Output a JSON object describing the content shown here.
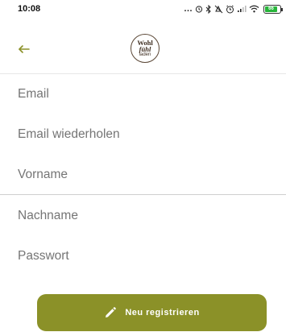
{
  "status_bar": {
    "time": "10:08",
    "battery": "66"
  },
  "header": {
    "logo_line1": "Wohl",
    "logo_line2": "fühl",
    "logo_line3": "laden"
  },
  "form": {
    "email_placeholder": "Email",
    "email_repeat_placeholder": "Email wiederholen",
    "firstname_placeholder": "Vorname",
    "lastname_placeholder": "Nachname",
    "password_placeholder": "Passwort"
  },
  "actions": {
    "register_label": "Neu registrieren"
  },
  "colors": {
    "accent": "#8b9128",
    "back_arrow": "#8b9128"
  }
}
